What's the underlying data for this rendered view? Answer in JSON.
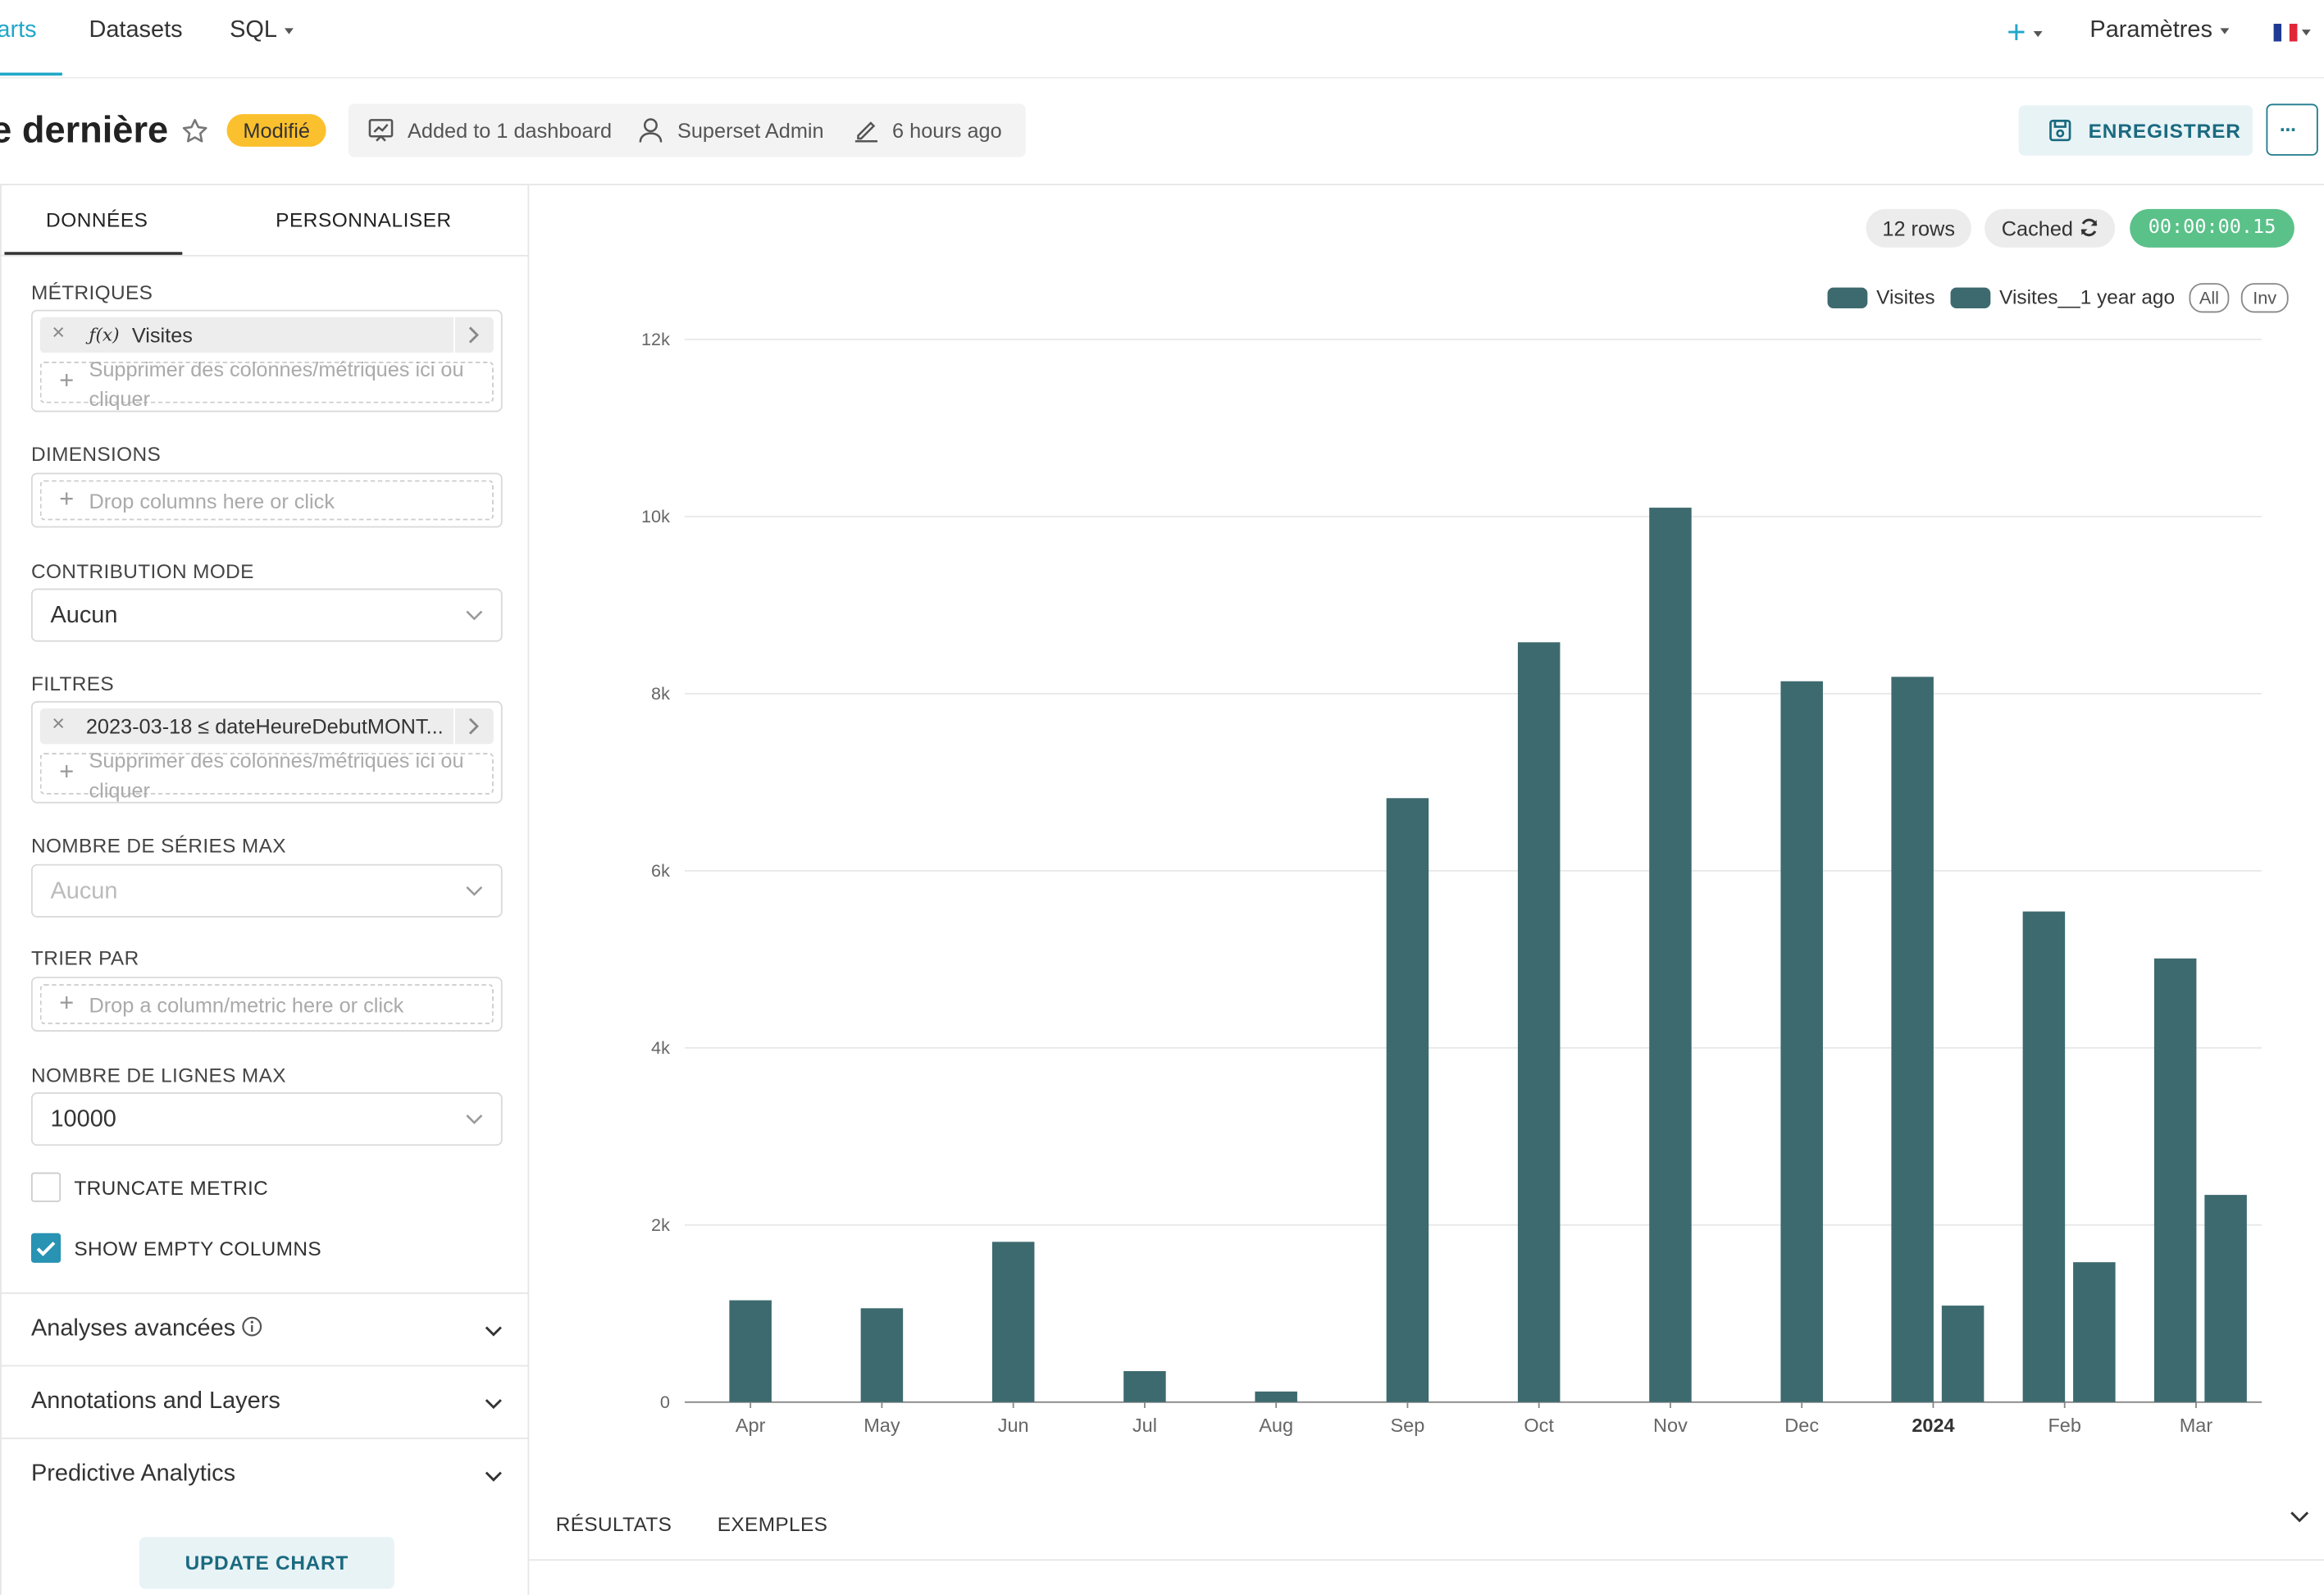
{
  "nav": {
    "charts_label": "arts",
    "datasets_label": "Datasets",
    "sql_label": "SQL",
    "plus_label": "+",
    "settings_label": "Paramètres",
    "language_icon": "french-flag-icon"
  },
  "header": {
    "title": "e dernière",
    "status_badge": "Modifié",
    "dashboard_info": "Added to 1 dashboard",
    "owner": "Superset Admin",
    "modified": "6 hours ago",
    "save_label": "ENREGISTRER",
    "more_label": "···"
  },
  "panel": {
    "tabs": [
      {
        "label": "DONNÉES",
        "active": true
      },
      {
        "label": "PERSONNALISER",
        "active": false
      }
    ],
    "metrics": {
      "label": "MÉTRIQUES",
      "pill_prefix": "ƒ(x)",
      "pill_text": "Visites",
      "drop_text": "Supprimer des colonnes/métriques ici ou cliquer"
    },
    "dimensions": {
      "label": "DIMENSIONS",
      "drop_text": "Drop columns here or click"
    },
    "contribution": {
      "label": "CONTRIBUTION MODE",
      "value": "Aucun"
    },
    "filters": {
      "label": "FILTRES",
      "pill_text": "2023-03-18 ≤ dateHeureDebutMONT...",
      "drop_text": "Supprimer des colonnes/métriques ici ou cliquer"
    },
    "series_limit": {
      "label": "NOMBRE DE SÉRIES MAX",
      "placeholder": "Aucun"
    },
    "sort_by": {
      "label": "TRIER PAR",
      "drop_text": "Drop a column/metric here or click"
    },
    "row_limit": {
      "label": "NOMBRE DE LIGNES MAX",
      "value": "10000"
    },
    "truncate_metric": {
      "label": "TRUNCATE METRIC",
      "checked": false
    },
    "show_empty": {
      "label": "SHOW EMPTY COLUMNS",
      "checked": true
    },
    "sections": [
      {
        "label": "Analyses avancées",
        "has_info": true
      },
      {
        "label": "Annotations and Layers",
        "has_info": false
      },
      {
        "label": "Predictive Analytics",
        "has_info": false
      }
    ],
    "update_label": "UPDATE CHART"
  },
  "status": {
    "rows": "12 rows",
    "cached": "Cached",
    "timer": "00:00:00.15",
    "timer_color": "#5ac189"
  },
  "legend": {
    "all_label": "All",
    "inv_label": "Inv"
  },
  "chart_data": {
    "type": "bar",
    "categories": [
      "Apr",
      "May",
      "Jun",
      "Jul",
      "Aug",
      "Sep",
      "Oct",
      "Nov",
      "Dec",
      "2024",
      "Feb",
      "Mar"
    ],
    "series": [
      {
        "name": "Visites",
        "color": "#3d6a6e",
        "values": [
          1150,
          1060,
          1810,
          350,
          120,
          6820,
          8580,
          10100,
          8140,
          8190,
          5540,
          5010
        ]
      },
      {
        "name": "Visites__1 year ago",
        "color": "#3d6a6e",
        "values": [
          null,
          null,
          null,
          null,
          null,
          null,
          null,
          null,
          null,
          1090,
          1580,
          2340
        ]
      }
    ],
    "yticks": [
      "0",
      "2k",
      "4k",
      "6k",
      "8k",
      "10k",
      "12k"
    ],
    "ylim": [
      0,
      12000
    ],
    "grid": true,
    "legend_position": "top-right"
  },
  "bottom_tabs": {
    "results_label": "RÉSULTATS",
    "samples_label": "EXEMPLES"
  }
}
